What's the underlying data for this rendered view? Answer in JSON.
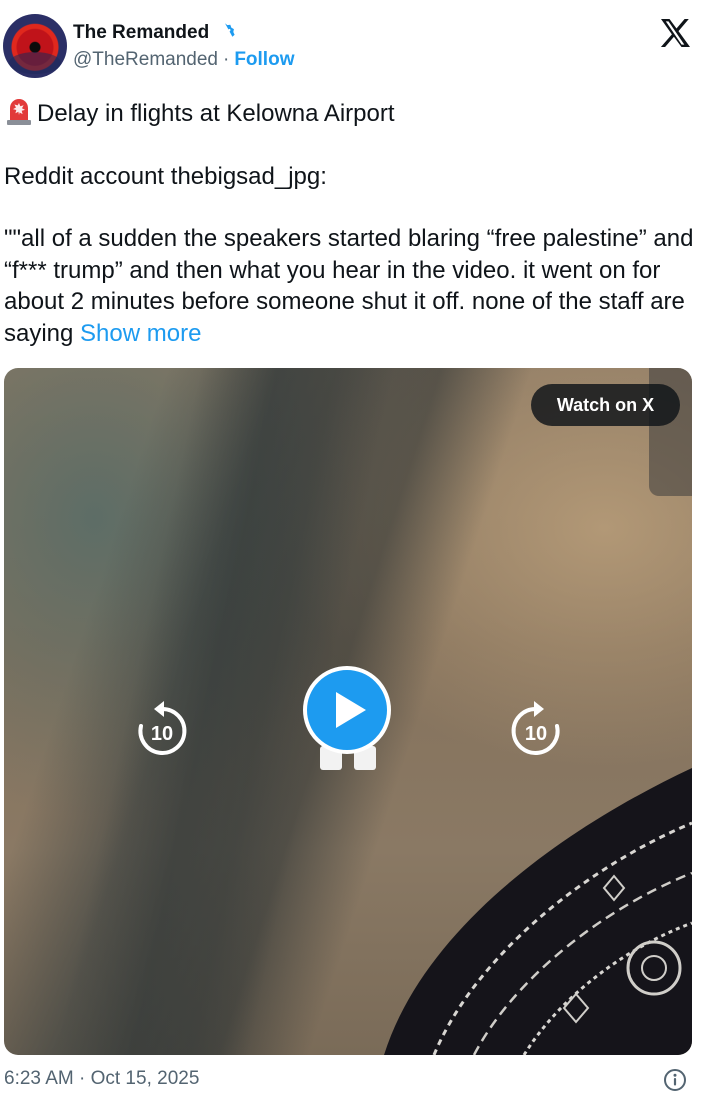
{
  "author": {
    "display_name": "The Remanded",
    "handle": "@TheRemanded",
    "separator": "·",
    "follow_label": "Follow",
    "verified_color": "#1d9bf0"
  },
  "tweet": {
    "line1": "Delay in flights at Kelowna Airport",
    "line2": "Reddit account thebigsad_jpg:",
    "quote": "\"\"all of a sudden the speakers started blaring “free palestine” and “f*** trump” and then what you hear in the video. it went on for about 2 minutes before someone shut it off. none of the staff are saying ",
    "show_more_label": "Show more"
  },
  "media": {
    "watch_on_x_label": "Watch on X",
    "seek_back_value": "10",
    "seek_forward_value": "10",
    "play_color": "#1d9bf0"
  },
  "footer": {
    "timestamp": "6:23 AM · Oct 15, 2025"
  },
  "icons": {
    "alert": "police-light-emoji",
    "verified": "verified-badge-icon",
    "x": "x-logo-icon",
    "info": "info-icon"
  }
}
